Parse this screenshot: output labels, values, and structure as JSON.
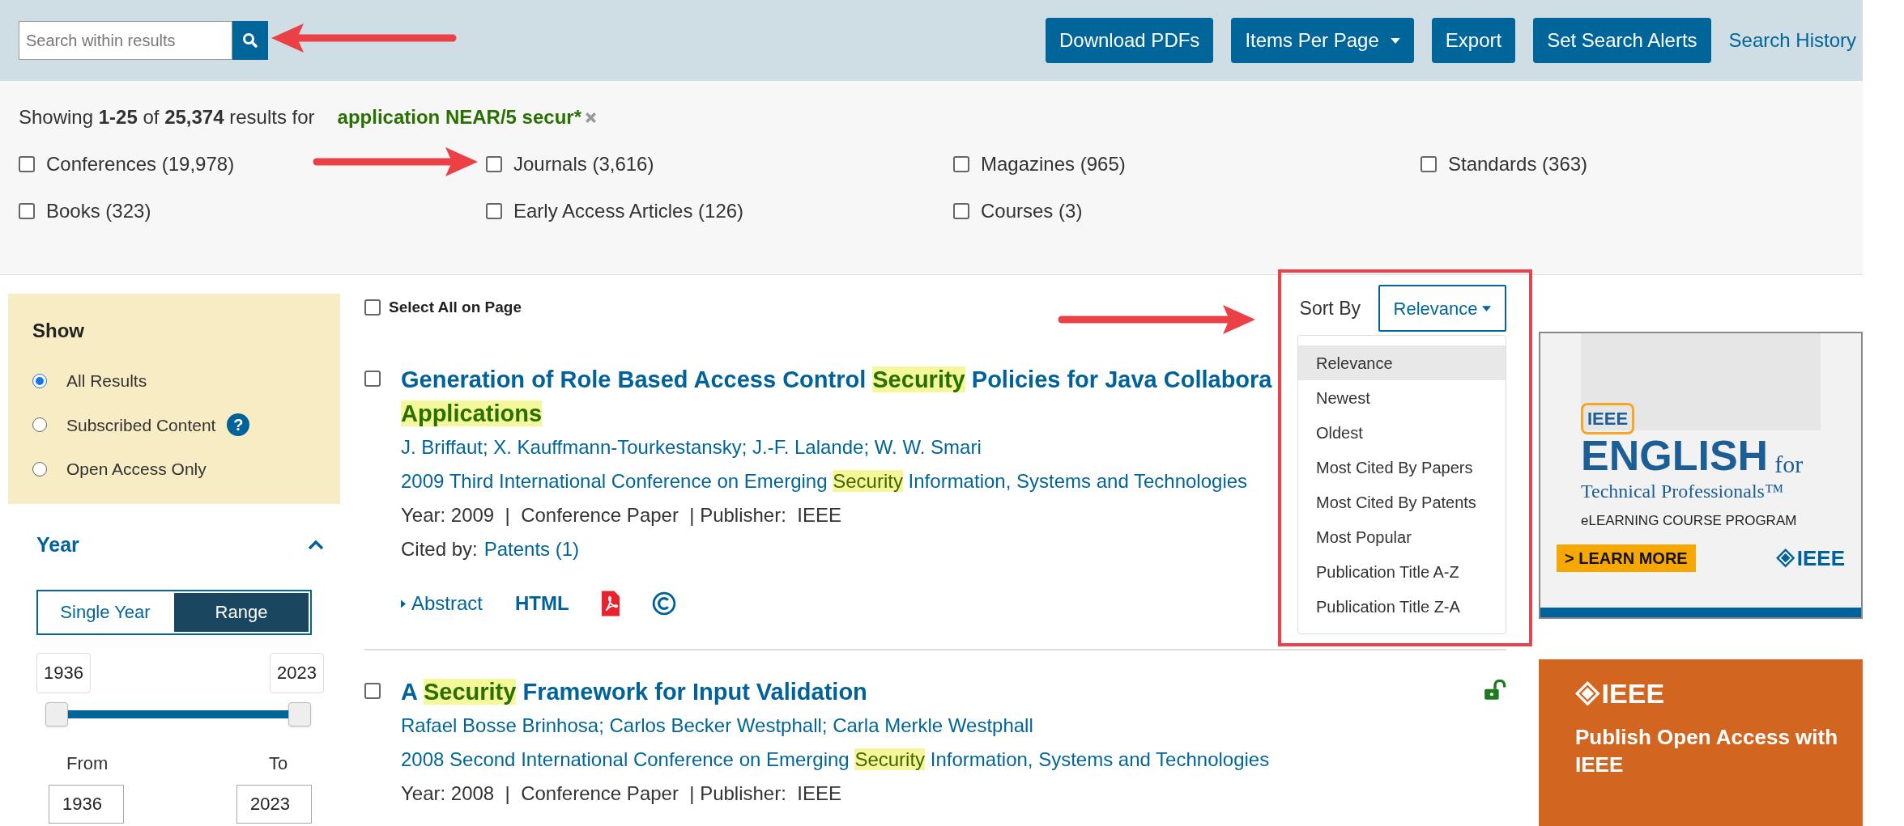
{
  "search": {
    "placeholder": "Search within results"
  },
  "toolbar": {
    "buttons": [
      {
        "label": "Download PDFs",
        "kind": "button"
      },
      {
        "label": "Items Per Page",
        "kind": "dropdown"
      },
      {
        "label": "Export",
        "kind": "button"
      },
      {
        "label": "Set Search Alerts",
        "kind": "button"
      }
    ],
    "link": "Search History"
  },
  "summary": {
    "text": "Showing **1-25** of  **25,374**  results for",
    "query": "application NEAR/5 secur*"
  },
  "filters": [
    {
      "label": "Conferences (19,978)",
      "checked": false
    },
    {
      "label": "Journals (3,616)",
      "checked": false
    },
    {
      "label": "Magazines (965)",
      "checked": false
    },
    {
      "label": "Standards (363)",
      "checked": false
    },
    {
      "label": "Books (323)",
      "checked": false
    },
    {
      "label": "Early Access Articles (126)",
      "checked": false
    },
    {
      "label": "Courses (3)",
      "checked": false
    }
  ],
  "sidebar": {
    "show": {
      "title": "Show",
      "options": [
        {
          "label": "All Results",
          "selected": true
        },
        {
          "label": "Subscribed Content",
          "selected": false,
          "help": "?"
        },
        {
          "label": "Open Access Only",
          "selected": false
        }
      ]
    },
    "year": {
      "title": "Year",
      "expanded": true,
      "modes": [
        {
          "label": "Single Year",
          "selected": false
        },
        {
          "label": "Range",
          "selected": true
        }
      ],
      "range_min": "1936",
      "range_max": "2023",
      "low": {
        "level": 0
      },
      "high": {
        "level": 1
      },
      "from_label": "From",
      "from": "1936",
      "to_label": "To",
      "to": "2023"
    }
  },
  "results": {
    "select_all": {
      "label": "Select All on Page",
      "checked": false
    },
    "items": [
      {
        "checked": false,
        "open_access": false,
        "title": [
          {
            "text": "Generation of Role Based Access Control ",
            "highlight": false
          },
          {
            "text": "Security",
            "highlight": true
          },
          {
            "text": " Policies for Java Collabora\n",
            "highlight": false
          },
          {
            "text": "Applications",
            "highlight": true
          }
        ],
        "authors": "J. Briffaut; X. Kauffmann-Tourkestansky; J.-F. Lalande; W. W. Smari",
        "venue": [
          {
            "text": "2009 Third International Conference on Emerging ",
            "highlight": false
          },
          {
            "text": "Security",
            "highlight": true
          },
          {
            "text": " Information, Systems and Technologies",
            "highlight": false
          }
        ],
        "meta": "Year: 2009  |  Conference Paper  | Publisher:  IEEE",
        "cited_label": "Cited by:",
        "cited": "Patents (1)",
        "abstract": "Abstract",
        "html": "HTML"
      },
      {
        "checked": false,
        "open_access": true,
        "title": [
          {
            "text": "A ",
            "highlight": false
          },
          {
            "text": "Security",
            "highlight": true
          },
          {
            "text": " Framework for Input Validation",
            "highlight": false
          }
        ],
        "authors": "Rafael Bosse Brinhosa; Carlos Becker Westphall; Carla Merkle Westphall",
        "venue": [
          {
            "text": "2008 Second International Conference on Emerging ",
            "highlight": false
          },
          {
            "text": "Security",
            "highlight": true
          },
          {
            "text": " Information, Systems and Technologies",
            "highlight": false
          }
        ],
        "meta": "Year: 2008  |  Conference Paper  | Publisher:  IEEE"
      }
    ]
  },
  "sort": {
    "label": "Sort By",
    "value": "Relevance",
    "open": true,
    "options": [
      {
        "label": "Relevance",
        "selected": true
      },
      {
        "label": "Newest",
        "selected": false
      },
      {
        "label": "Oldest",
        "selected": false
      },
      {
        "label": "Most Cited By Papers",
        "selected": false
      },
      {
        "label": "Most Cited By Patents",
        "selected": false
      },
      {
        "label": "Most Popular",
        "selected": false
      },
      {
        "label": "Publication Title A-Z",
        "selected": false
      },
      {
        "label": "Publication Title Z-A",
        "selected": false
      }
    ]
  },
  "ads": [
    {
      "kind": "course",
      "badge": "IEEE",
      "headline": "ENGLISH",
      "headline_suffix": "for",
      "subtitle": "Technical Professionals™",
      "program": "eLEARNING COURSE PROGRAM",
      "cta": "> LEARN MORE",
      "logo": "IEEE"
    },
    {
      "kind": "publish",
      "logo": "IEEE",
      "headline": "Publish Open Access with IEEE"
    }
  ]
}
